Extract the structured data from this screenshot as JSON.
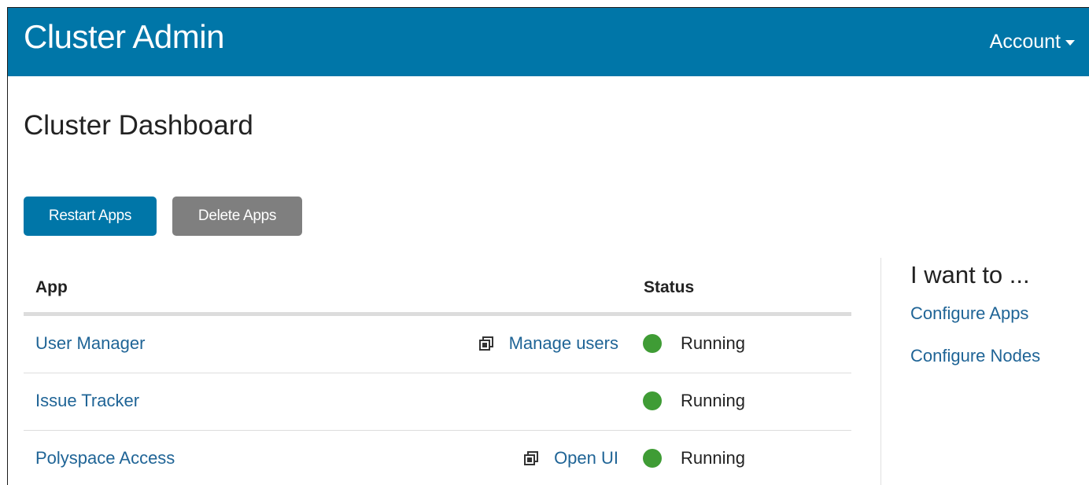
{
  "navbar": {
    "brand": "Cluster Admin",
    "account_label": "Account"
  },
  "page": {
    "title": "Cluster Dashboard"
  },
  "toolbar": {
    "restart_label": "Restart Apps",
    "delete_label": "Delete Apps"
  },
  "table": {
    "headers": {
      "app": "App",
      "status": "Status"
    },
    "rows": [
      {
        "app": "User Manager",
        "action": "Manage users",
        "status": "Running"
      },
      {
        "app": "Issue Tracker",
        "action": "",
        "status": "Running"
      },
      {
        "app": "Polyspace Access",
        "action": "Open UI",
        "status": "Running"
      }
    ]
  },
  "sidebar": {
    "title": "I want to ...",
    "links": [
      "Configure Apps",
      "Configure Nodes"
    ]
  },
  "colors": {
    "brand_blue": "#0076a8",
    "secondary_gray": "#7f7f7f",
    "link_blue": "#1f6496",
    "status_green": "#3f9c35"
  },
  "icons": {
    "action_icon": "external-window-icon",
    "status_icon": "status-dot-icon",
    "account_caret": "caret-down-icon"
  }
}
